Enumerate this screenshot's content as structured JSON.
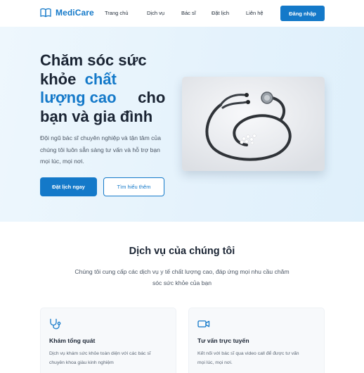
{
  "brand": {
    "name": "MediCare",
    "accent": "#1479c9",
    "icon": "book-open-icon"
  },
  "nav": {
    "items": [
      {
        "label": "Trang chủ"
      },
      {
        "label": "Dịch vụ"
      },
      {
        "label": "Bác sĩ"
      },
      {
        "label": "Đặt lịch"
      },
      {
        "label": "Liên hệ"
      }
    ],
    "login_label": "Đăng nhập"
  },
  "hero": {
    "title_line1": "Chăm sóc sức",
    "title_word_khoe": "khỏe",
    "title_highlight_1": "chất",
    "title_highlight_2": "lượng cao",
    "title_word_cho": "cho",
    "title_line4": "bạn và gia đình",
    "description": "Đội ngũ bác sĩ chuyên nghiệp và tận tâm của chúng tôi luôn sẵn sàng tư vấn và hỗ trợ bạn mọi lúc, mọi nơi.",
    "primary_button": "Đặt lịch ngay",
    "secondary_button": "Tìm hiểu thêm",
    "image_icon": "stethoscope-image"
  },
  "services": {
    "title": "Dịch vụ của chúng tôi",
    "subtitle": "Chúng tôi cung cấp các dịch vụ y tế chất lượng cao, đáp ứng mọi nhu cầu chăm sóc sức khỏe của bạn",
    "cards": [
      {
        "icon": "stethoscope-icon",
        "title": "Khám tổng quát",
        "description": "Dịch vụ khám sức khỏe toàn diện với các bác sĩ chuyên khoa giàu kinh nghiệm"
      },
      {
        "icon": "video-camera-icon",
        "title": "Tư vấn trực tuyến",
        "description": "Kết nối với bác sĩ qua video call để được tư vấn mọi lúc, mọi nơi."
      }
    ]
  }
}
